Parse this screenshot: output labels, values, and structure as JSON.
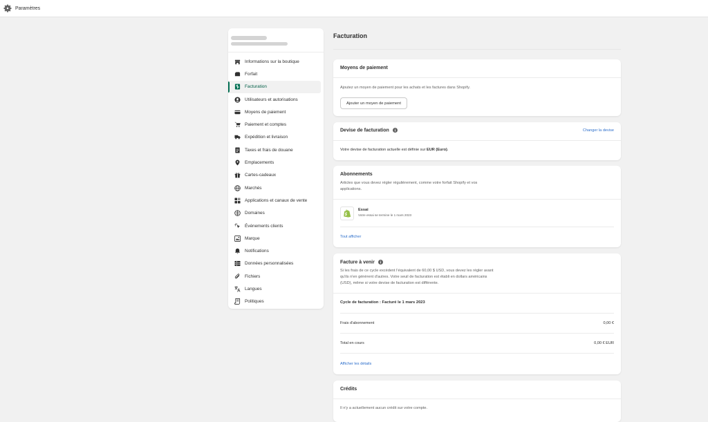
{
  "topbar": {
    "title": "Paramètres"
  },
  "sidebar": {
    "items": [
      {
        "label": "Informations sur la boutique",
        "icon": "store-icon"
      },
      {
        "label": "Forfait",
        "icon": "plan-icon"
      },
      {
        "label": "Facturation",
        "icon": "billing-icon",
        "active": true
      },
      {
        "label": "Utilisateurs et autorisations",
        "icon": "user-icon"
      },
      {
        "label": "Moyens de paiement",
        "icon": "payment-icon"
      },
      {
        "label": "Paiement et comptes",
        "icon": "checkout-icon"
      },
      {
        "label": "Expédition et livraison",
        "icon": "truck-icon"
      },
      {
        "label": "Taxes et frais de douane",
        "icon": "tax-icon"
      },
      {
        "label": "Emplacements",
        "icon": "location-icon"
      },
      {
        "label": "Cartes-cadeaux",
        "icon": "gift-icon"
      },
      {
        "label": "Marchés",
        "icon": "globe-icon"
      },
      {
        "label": "Applications et canaux de vente",
        "icon": "apps-icon"
      },
      {
        "label": "Domaines",
        "icon": "domain-icon"
      },
      {
        "label": "Événements clients",
        "icon": "cursor-icon"
      },
      {
        "label": "Marque",
        "icon": "brand-icon"
      },
      {
        "label": "Notifications",
        "icon": "bell-icon"
      },
      {
        "label": "Données personnalisées",
        "icon": "data-icon"
      },
      {
        "label": "Fichiers",
        "icon": "paperclip-icon"
      },
      {
        "label": "Langues",
        "icon": "language-icon"
      },
      {
        "label": "Politiques",
        "icon": "policy-icon"
      }
    ]
  },
  "main": {
    "title": "Facturation"
  },
  "payment_card": {
    "title": "Moyens de paiement",
    "desc": "Ajoutez un moyen de paiement pour les achats et les factures dans Shopify.",
    "button": "Ajouter un moyen de paiement"
  },
  "currency_card": {
    "title": "Devise de facturation",
    "link": "Changer la devise",
    "text_prefix": "Votre devise de facturation actuelle est définie sur ",
    "currency": "EUR (Euro)",
    "text_suffix": "."
  },
  "subs_card": {
    "title": "Abonnements",
    "desc_line1": "Articles que vous devez régler régulièrement, comme votre forfait Shopify et vos",
    "desc_line2": "applications.",
    "item_title": "Essai",
    "item_sub": "Votre essai se termine le 1 mars 2023",
    "link": "Tout afficher"
  },
  "invoice_card": {
    "title": "Facture à venir",
    "desc_line1": "Si les frais de ce cycle excèdent l'équivalent de 60,00 $ USD, vous devez les régler avant",
    "desc_line2": "qu'ils n'en génèrent d'autres. Votre seuil de facturation est établi en dollars américains",
    "desc_line3": "(USD), même si votre devise de facturation est différente.",
    "cycle": "Cycle de facturation : Facturé le 1 mars 2023",
    "fee_label": "Frais d'abonnement",
    "fee_value": "0,00 €",
    "total_label": "Total en cours",
    "total_value": "0,00 € EUR",
    "details_link": "Afficher les détails"
  },
  "credits_card": {
    "title": "Crédits",
    "desc": "Il n'y a actuellement aucun crédit sur votre compte."
  },
  "colors": {
    "accent": "#006e52",
    "link": "#2c6ecb",
    "background": "#f1f1f1"
  }
}
